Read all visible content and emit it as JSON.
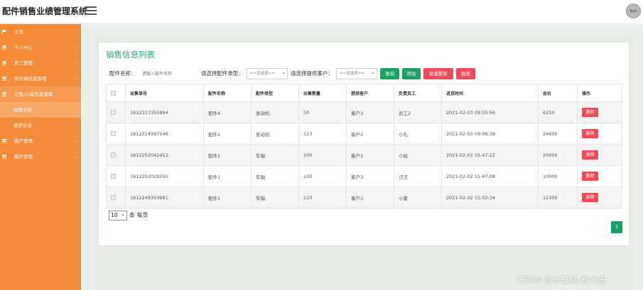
{
  "app": {
    "title": "配件销售业绩管理系统",
    "avatar_text": "Bubt"
  },
  "sidebar": {
    "items": [
      {
        "label": "主页",
        "icon": "flag-icon",
        "arrow": ""
      },
      {
        "label": "个人中心",
        "icon": "list-icon",
        "arrow": "⌄"
      },
      {
        "label": "员工管理",
        "icon": "list-icon",
        "arrow": "⌄"
      },
      {
        "label": "供应商信息管理",
        "icon": "list-icon",
        "arrow": "⌄"
      },
      {
        "label": "出售/入库信息管理",
        "icon": "list-icon",
        "arrow": "⌃"
      }
    ],
    "subitems": [
      {
        "label": "出售信息"
      },
      {
        "label": "进货信息"
      }
    ],
    "items_after": [
      {
        "label": "客户管理",
        "icon": "list-icon",
        "arrow": "⌄"
      },
      {
        "label": "配件管理",
        "icon": "list-icon",
        "arrow": "⌄"
      }
    ]
  },
  "page": {
    "title": "销售信息列表"
  },
  "search": {
    "name_label": "配件名称：",
    "name_placeholder": "请输入配件名称",
    "type_label": "请选择配件类型：",
    "type_value": "==请选择==",
    "customer_label": "请选择提供客户：",
    "customer_value": "==请选择==",
    "query_btn": "查询",
    "add_btn": "添加",
    "batch_delete_btn": "批量删除",
    "report_btn": "报表"
  },
  "table": {
    "headers": [
      "",
      "出售单号",
      "配件名称",
      "配件类型",
      "出售数量",
      "提供客户",
      "负责员工",
      "进货时间",
      "总价",
      "操作"
    ],
    "delete_label": "删除",
    "rows": [
      [
        "1612317355894",
        "配件4",
        "发动机",
        "50",
        "客户3",
        "员工2",
        "2021-02-03 09:55:56",
        "6150"
      ],
      [
        "1612314397546",
        "配件2",
        "发动机",
        "123",
        "客户2",
        "小礼",
        "2021-02-03 09:06:38",
        "24600"
      ],
      [
        "1612252042453",
        "配件1",
        "车轴",
        "200",
        "客户2",
        "小姑",
        "2021-02-02 15:47:22",
        "20000"
      ],
      [
        "1612252028255",
        "配件1",
        "车轴",
        "100",
        "客户3",
        "汪汪",
        "2021-02-02 15:47:08",
        "10000"
      ],
      [
        "1612249353681",
        "配件1",
        "车轴",
        "123",
        "客户3",
        "小夏",
        "2021-02-02 15:02:34",
        "12300"
      ]
    ]
  },
  "pager": {
    "page_size": "10",
    "per_page_label": "条 每页",
    "current_page": "1"
  },
  "watermark": "CSDN @计算机-秋大田"
}
